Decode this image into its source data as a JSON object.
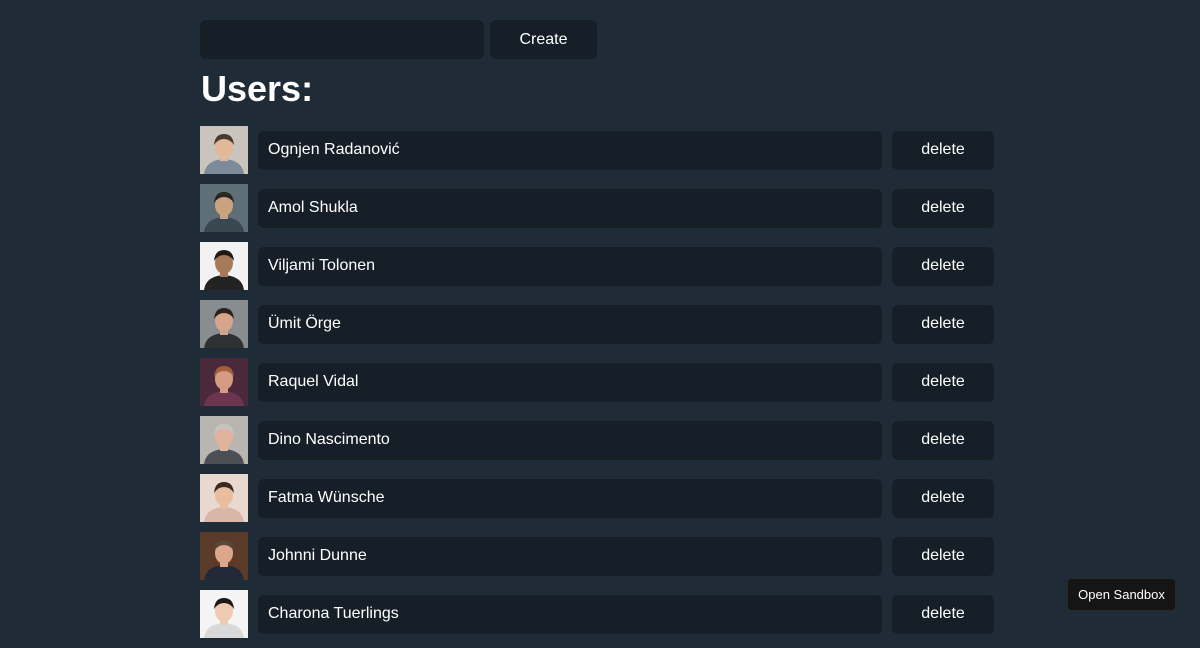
{
  "create_form": {
    "input_value": "",
    "create_label": "Create"
  },
  "users_title": "Users:",
  "users": [
    {
      "name": "Ognjen Radanović",
      "delete_label": "delete",
      "avatar_colors": {
        "bg": "#c9c4bd",
        "skin": "#e2b89a",
        "hair": "#4a3a2c",
        "shirt": "#7d8a99"
      }
    },
    {
      "name": "Amol Shukla",
      "delete_label": "delete",
      "avatar_colors": {
        "bg": "#5f6f77",
        "skin": "#c9a27f",
        "hair": "#2b2420",
        "shirt": "#394850"
      }
    },
    {
      "name": "Viljami Tolonen",
      "delete_label": "delete",
      "avatar_colors": {
        "bg": "#f2f2f2",
        "skin": "#a77a5c",
        "hair": "#1d1a18",
        "shirt": "#222222"
      }
    },
    {
      "name": "Ümit Örge",
      "delete_label": "delete",
      "avatar_colors": {
        "bg": "#8a8d8f",
        "skin": "#d3a58a",
        "hair": "#2a231e",
        "shirt": "#2d3134"
      }
    },
    {
      "name": "Raquel Vidal",
      "delete_label": "delete",
      "avatar_colors": {
        "bg": "#4a2a3a",
        "skin": "#d59c83",
        "hair": "#a15f3f",
        "shirt": "#6b3550"
      }
    },
    {
      "name": "Dino Nascimento",
      "delete_label": "delete",
      "avatar_colors": {
        "bg": "#b9b6b1",
        "skin": "#dfb39c",
        "hair": "#c8c3bd",
        "shirt": "#4c4f55"
      }
    },
    {
      "name": "Fatma Wünsche",
      "delete_label": "delete",
      "avatar_colors": {
        "bg": "#e9d8cf",
        "skin": "#e8bda0",
        "hair": "#3b2a22",
        "shirt": "#d8b7a8"
      }
    },
    {
      "name": "Johnni Dunne",
      "delete_label": "delete",
      "avatar_colors": {
        "bg": "#5b3a2a",
        "skin": "#dba88c",
        "hair": "#5a4636",
        "shirt": "#222a3a"
      }
    },
    {
      "name": "Charona Tuerlings",
      "delete_label": "delete",
      "avatar_colors": {
        "bg": "#f4f4f4",
        "skin": "#efcab2",
        "hair": "#1d1816",
        "shirt": "#d9d9d9"
      }
    }
  ],
  "sandbox_button_label": "Open Sandbox"
}
